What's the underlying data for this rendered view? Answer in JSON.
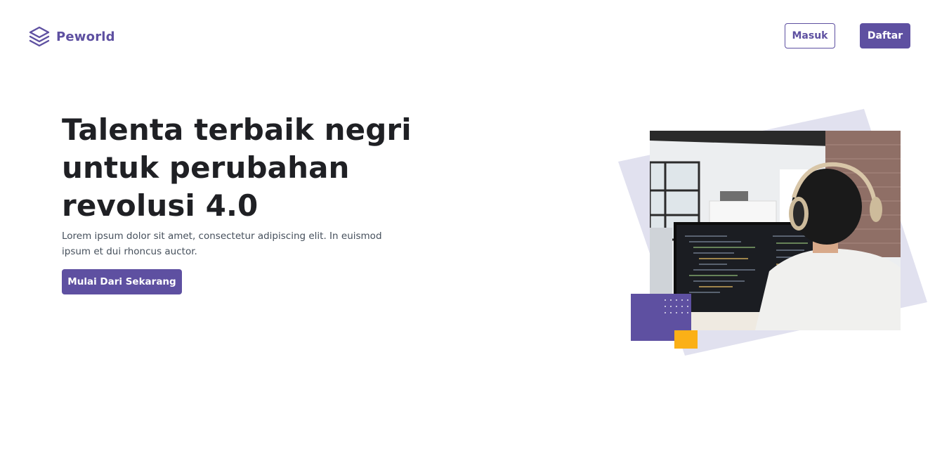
{
  "brand": {
    "name": "Peworld",
    "icon": "layers-icon",
    "color": "#5e50a1"
  },
  "nav": {
    "login_label": "Masuk",
    "register_label": "Daftar"
  },
  "hero": {
    "title": "Talenta terbaik negri untuk perubahan revolusi 4.0",
    "description": "Lorem ipsum dolor sit amet, consectetur adipiscing elit. In euismod ipsum et dui rhoncus auctor.",
    "cta_label": "Mulai Dari Sekarang",
    "image_icon": "developer-photo"
  },
  "colors": {
    "primary": "#5e50a1",
    "accent": "#fbb017",
    "tilted_bg": "#e1e1ef",
    "text_dark": "#1f2024",
    "text_muted": "#46505c"
  }
}
